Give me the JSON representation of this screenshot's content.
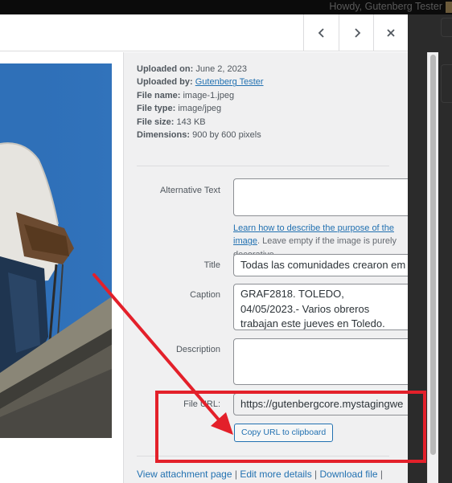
{
  "adminbar": {
    "greeting": "Howdy, Gutenberg Tester"
  },
  "header": {
    "prev_icon": "chevron-left-icon",
    "next_icon": "chevron-right-icon",
    "close_icon": "close-icon"
  },
  "details": {
    "uploaded_on_label": "Uploaded on:",
    "uploaded_on": "June 2, 2023",
    "uploaded_by_label": "Uploaded by:",
    "uploaded_by": "Gutenberg Tester",
    "file_name_label": "File name:",
    "file_name": "image-1.jpeg",
    "file_type_label": "File type:",
    "file_type": "image/jpeg",
    "file_size_label": "File size:",
    "file_size": "143 KB",
    "dimensions_label": "Dimensions:",
    "dimensions": "900 by 600 pixels"
  },
  "form": {
    "alt_label": "Alternative Text",
    "alt_value": "",
    "alt_help_link": "Learn how to describe the purpose of the image",
    "alt_help_text": ". Leave empty if the image is purely decorative.",
    "title_label": "Title",
    "title_value": "Todas las comunidades crearon em",
    "caption_label": "Caption",
    "caption_value": "GRAF2818. TOLEDO, 04/05/2023.- Varios obreros trabajan este jueves en Toledo.",
    "description_label": "Description",
    "description_value": "",
    "file_url_label": "File URL:",
    "file_url_value": "https://gutenbergcore.mystagingwe",
    "copy_button": "Copy URL to clipboard"
  },
  "footer_links": {
    "view": "View attachment page",
    "edit": "Edit more details",
    "download": "Download file",
    "separator": " | "
  },
  "annotation": {
    "highlight_color": "#e3202a"
  }
}
